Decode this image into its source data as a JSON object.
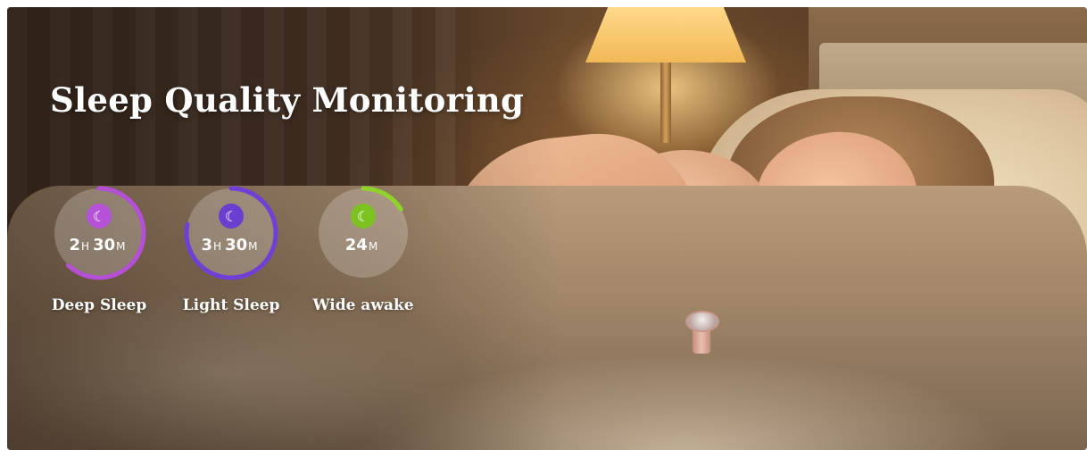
{
  "hero": {
    "title": "Sleep Quality Monitoring"
  },
  "metrics": [
    {
      "label": "Deep Sleep",
      "hours": "2",
      "hours_unit": "H",
      "minutes": "30",
      "minutes_unit": "M",
      "icon": "moon-icon",
      "color": "#b44fd6",
      "icon_bg": "#b552d8",
      "progress": 0.62
    },
    {
      "label": "Light Sleep",
      "hours": "3",
      "hours_unit": "H",
      "minutes": "30",
      "minutes_unit": "M",
      "icon": "moon-stars-icon",
      "color": "#7040d6",
      "icon_bg": "#6a3fd0",
      "progress": 0.78
    },
    {
      "label": "Wide awake",
      "minutes": "24",
      "minutes_unit": "M",
      "icon": "moon-icon",
      "color": "#8fd42a",
      "icon_bg": "#7cc322",
      "progress": 0.16
    }
  ]
}
